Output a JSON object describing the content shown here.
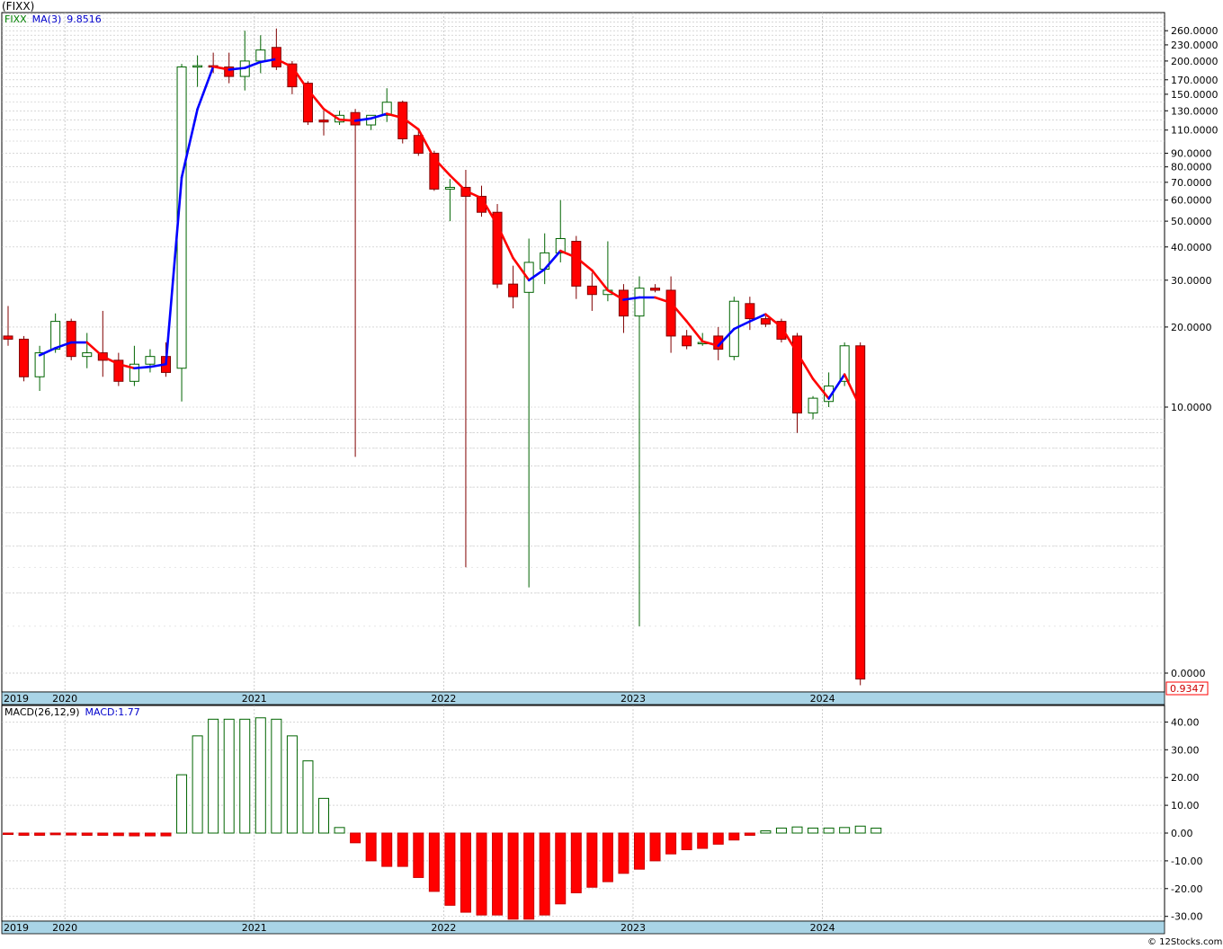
{
  "header": {
    "symbol": "(FIXX)"
  },
  "price_panel": {
    "legend_symbol": "FIXX",
    "ma_label": "MA(3)",
    "ma_value": "9.8516",
    "last_price_label": "0.9347"
  },
  "macd_panel": {
    "label": "MACD(26,12,9)",
    "value_label": "MACD:1.77"
  },
  "watermark": "© 12Stocks.com",
  "colors": {
    "up_candle": "#006400",
    "down_candle": "#ff0000",
    "ma_up": "#0000ff",
    "ma_down": "#ff0000",
    "date_strip": "#a9d4e6",
    "grid": "#c0c0c0",
    "macd_pos": "#006400",
    "macd_neg": "#ff0000"
  },
  "chart_data": [
    {
      "type": "candlestick",
      "scale": "log",
      "y_ticks": [
        "260.0000",
        "230.0000",
        "200.0000",
        "170.0000",
        "150.0000",
        "130.0000",
        "110.0000",
        "90.0000",
        "80.0000",
        "70.0000",
        "60.0000",
        "50.0000",
        "40.0000",
        "30.0000",
        "20.0000",
        "10.0000",
        "0.0000"
      ],
      "x_labels": [
        "2019",
        "2020",
        "2021",
        "2022",
        "2023",
        "2024"
      ],
      "ma_label": "MA(3)",
      "series": [
        {
          "date": "2019-11",
          "o": 18.5,
          "h": 24,
          "l": 17,
          "c": 18
        },
        {
          "date": "2019-12",
          "o": 18,
          "h": 18.5,
          "l": 12.5,
          "c": 13
        },
        {
          "date": "2020-01",
          "o": 13,
          "h": 17,
          "l": 11.5,
          "c": 16
        },
        {
          "date": "2020-02",
          "o": 16.5,
          "h": 22.5,
          "l": 16,
          "c": 21
        },
        {
          "date": "2020-03",
          "o": 21,
          "h": 21.5,
          "l": 15,
          "c": 15.5
        },
        {
          "date": "2020-04",
          "o": 15.5,
          "h": 19,
          "l": 14,
          "c": 16
        },
        {
          "date": "2020-05",
          "o": 16,
          "h": 23,
          "l": 13,
          "c": 15
        },
        {
          "date": "2020-06",
          "o": 15,
          "h": 16,
          "l": 12,
          "c": 12.5
        },
        {
          "date": "2020-07",
          "o": 12.5,
          "h": 17,
          "l": 12,
          "c": 14.5
        },
        {
          "date": "2020-08",
          "o": 14.5,
          "h": 16.5,
          "l": 13.5,
          "c": 15.5
        },
        {
          "date": "2020-09",
          "o": 15.5,
          "h": 17.5,
          "l": 13,
          "c": 13.5
        },
        {
          "date": "2020-10",
          "o": 14,
          "h": 195,
          "l": 10.5,
          "c": 190
        },
        {
          "date": "2020-11",
          "o": 190,
          "h": 210,
          "l": 160,
          "c": 192
        },
        {
          "date": "2020-12",
          "o": 192,
          "h": 215,
          "l": 180,
          "c": 190
        },
        {
          "date": "2021-01",
          "o": 190,
          "h": 215,
          "l": 165,
          "c": 175
        },
        {
          "date": "2021-02",
          "o": 175,
          "h": 260,
          "l": 155,
          "c": 200
        },
        {
          "date": "2021-03",
          "o": 200,
          "h": 250,
          "l": 180,
          "c": 220
        },
        {
          "date": "2021-04",
          "o": 225,
          "h": 265,
          "l": 185,
          "c": 190
        },
        {
          "date": "2021-05",
          "o": 195,
          "h": 200,
          "l": 150,
          "c": 160
        },
        {
          "date": "2021-06",
          "o": 165,
          "h": 168,
          "l": 115,
          "c": 118
        },
        {
          "date": "2021-07",
          "o": 120,
          "h": 130,
          "l": 105,
          "c": 118
        },
        {
          "date": "2021-08",
          "o": 118,
          "h": 130,
          "l": 115,
          "c": 125
        },
        {
          "date": "2021-09",
          "o": 128,
          "h": 132,
          "l": 6.5,
          "c": 115
        },
        {
          "date": "2021-10",
          "o": 115,
          "h": 125,
          "l": 110,
          "c": 125
        },
        {
          "date": "2021-11",
          "o": 125,
          "h": 158,
          "l": 118,
          "c": 140
        },
        {
          "date": "2021-12",
          "o": 140,
          "h": 142,
          "l": 98,
          "c": 102
        },
        {
          "date": "2022-01",
          "o": 105,
          "h": 110,
          "l": 88,
          "c": 90
        },
        {
          "date": "2022-02",
          "o": 90,
          "h": 92,
          "l": 65,
          "c": 66
        },
        {
          "date": "2022-03",
          "o": 66,
          "h": 72,
          "l": 50,
          "c": 67
        },
        {
          "date": "2022-04",
          "o": 67,
          "h": 78,
          "l": 2.5,
          "c": 62
        },
        {
          "date": "2022-05",
          "o": 62,
          "h": 68,
          "l": 52,
          "c": 54
        },
        {
          "date": "2022-06",
          "o": 54,
          "h": 58,
          "l": 28,
          "c": 29
        },
        {
          "date": "2022-07",
          "o": 29,
          "h": 34,
          "l": 23.5,
          "c": 26
        },
        {
          "date": "2022-08",
          "o": 27,
          "h": 43,
          "l": 2.1,
          "c": 35
        },
        {
          "date": "2022-09",
          "o": 33,
          "h": 45,
          "l": 29,
          "c": 38
        },
        {
          "date": "2022-10",
          "o": 38,
          "h": 60,
          "l": 35,
          "c": 43
        },
        {
          "date": "2022-11",
          "o": 42,
          "h": 44,
          "l": 25.5,
          "c": 28.5
        },
        {
          "date": "2022-12",
          "o": 28.5,
          "h": 32,
          "l": 23,
          "c": 26.5
        },
        {
          "date": "2023-01",
          "o": 26.5,
          "h": 42,
          "l": 25,
          "c": 27.5
        },
        {
          "date": "2023-02",
          "o": 27.5,
          "h": 29,
          "l": 19,
          "c": 22
        },
        {
          "date": "2023-03",
          "o": 22,
          "h": 31,
          "l": 1.5,
          "c": 28
        },
        {
          "date": "2023-04",
          "o": 28,
          "h": 29,
          "l": 27,
          "c": 27.5
        },
        {
          "date": "2023-05",
          "o": 27.5,
          "h": 31,
          "l": 16,
          "c": 18.5
        },
        {
          "date": "2023-06",
          "o": 18.5,
          "h": 19.5,
          "l": 16.5,
          "c": 17
        },
        {
          "date": "2023-07",
          "o": 17.5,
          "h": 19,
          "l": 17,
          "c": 17.5
        },
        {
          "date": "2023-08",
          "o": 18.5,
          "h": 20,
          "l": 15,
          "c": 16.5
        },
        {
          "date": "2023-09",
          "o": 15.5,
          "h": 26,
          "l": 15,
          "c": 25
        },
        {
          "date": "2023-10",
          "o": 24.5,
          "h": 26,
          "l": 19.5,
          "c": 21.5
        },
        {
          "date": "2023-11",
          "o": 21.5,
          "h": 22,
          "l": 20,
          "c": 20.5
        },
        {
          "date": "2023-12",
          "o": 21,
          "h": 21.5,
          "l": 17.5,
          "c": 18
        },
        {
          "date": "2024-01",
          "o": 18.5,
          "h": 19,
          "l": 8,
          "c": 9.5
        },
        {
          "date": "2024-02",
          "o": 9.5,
          "h": 11,
          "l": 9,
          "c": 10.8
        },
        {
          "date": "2024-03",
          "o": 10.5,
          "h": 13.5,
          "l": 10,
          "c": 12
        },
        {
          "date": "2024-04",
          "o": 12.5,
          "h": 17.5,
          "l": 12,
          "c": 17
        },
        {
          "date": "2024-05",
          "o": 17,
          "h": 17.5,
          "l": 0.9,
          "c": 0.95
        }
      ]
    },
    {
      "type": "bar",
      "name": "MACD(26,12,9)",
      "y_ticks": [
        "40.00",
        "30.00",
        "20.00",
        "10.00",
        "0.00",
        "-10.00",
        "-20.00",
        "-30.00"
      ],
      "ylim": [
        -31,
        44
      ],
      "values": [
        -0.5,
        -0.8,
        -0.8,
        -0.6,
        -0.7,
        -0.8,
        -0.8,
        -0.9,
        -1,
        -1,
        -1,
        21,
        35,
        41,
        41,
        41,
        41.5,
        41,
        35,
        26,
        12.5,
        2,
        -3.5,
        -10,
        -12,
        -12,
        -16,
        -21,
        -26,
        -28.5,
        -29.5,
        -29.5,
        -31,
        -31,
        -29.5,
        -25.5,
        -21.5,
        -19.5,
        -17.5,
        -14.5,
        -13,
        -10,
        -7.5,
        -6,
        -5.5,
        -4,
        -2.5,
        -0.8,
        0.8,
        1.8,
        2.2,
        1.8,
        1.8,
        2,
        2.5,
        1.77
      ]
    }
  ]
}
